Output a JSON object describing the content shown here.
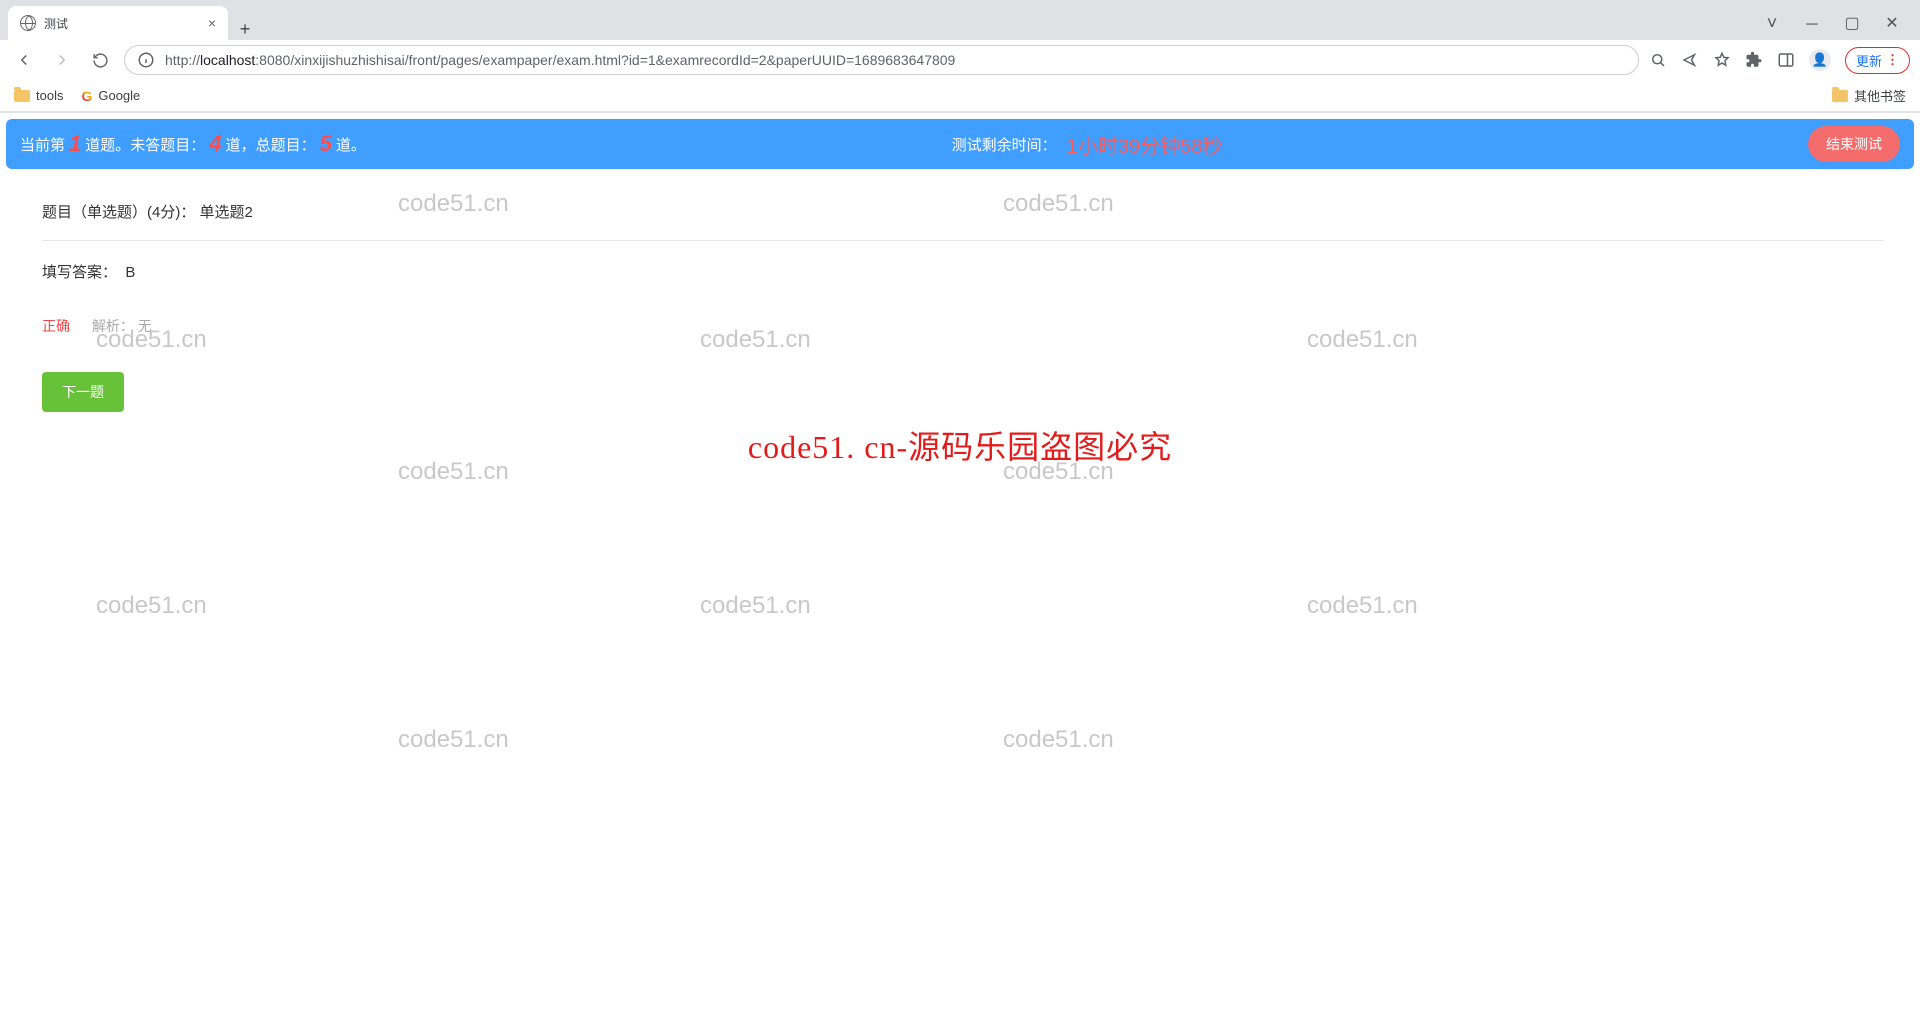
{
  "browser": {
    "tab_title": "测试",
    "url_prefix": "http://",
    "url_host": "localhost",
    "url_rest": ":8080/xinxijishuzhishisai/front/pages/exampaper/exam.html?id=1&examrecordId=2&paperUUID=1689683647809",
    "update_label": "更新",
    "bookmarks": {
      "tools": "tools",
      "google": "Google",
      "other": "其他书签"
    }
  },
  "exam_bar": {
    "txt_current_prefix": "当前第",
    "current_index": "1",
    "txt_current_suffix": "道题。",
    "txt_unanswered_prefix": "未答题目：",
    "unanswered": "4",
    "txt_unanswered_suffix": "道，",
    "txt_total_prefix": "总题目：",
    "total": "5",
    "txt_total_suffix": "道。",
    "timer_label": "测试剩余时间：",
    "timer_value": "1小时39分钟58秒",
    "end_label": "结束测试"
  },
  "question": {
    "title": "题目（单选题）(4分)：  单选题2",
    "answer_label": "填写答案：",
    "answer_value": "B",
    "result_label": "正确",
    "analysis_label": "解析：",
    "analysis_value": "无",
    "next_label": "下一题"
  },
  "big_watermark": "code51. cn-源码乐园盗图必究",
  "small_wm": "code51.cn"
}
